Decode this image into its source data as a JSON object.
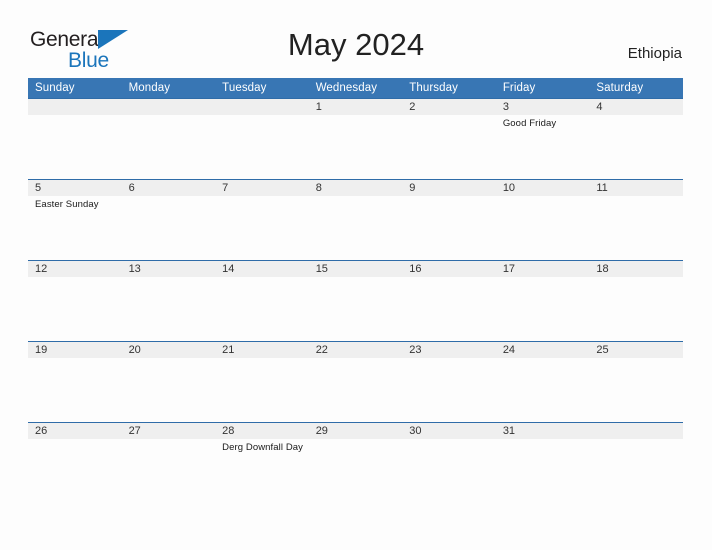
{
  "brand": {
    "name_top": "General",
    "name_bottom": "Blue",
    "flag_icon": "blue-triangle-flag-icon"
  },
  "header": {
    "title": "May 2024",
    "country": "Ethiopia"
  },
  "calendar": {
    "weekday_headers": [
      "Sunday",
      "Monday",
      "Tuesday",
      "Wednesday",
      "Thursday",
      "Friday",
      "Saturday"
    ],
    "weeks": [
      [
        {
          "day": "",
          "event": ""
        },
        {
          "day": "",
          "event": ""
        },
        {
          "day": "",
          "event": ""
        },
        {
          "day": "1",
          "event": ""
        },
        {
          "day": "2",
          "event": ""
        },
        {
          "day": "3",
          "event": "Good Friday"
        },
        {
          "day": "4",
          "event": ""
        }
      ],
      [
        {
          "day": "5",
          "event": "Easter Sunday"
        },
        {
          "day": "6",
          "event": ""
        },
        {
          "day": "7",
          "event": ""
        },
        {
          "day": "8",
          "event": ""
        },
        {
          "day": "9",
          "event": ""
        },
        {
          "day": "10",
          "event": ""
        },
        {
          "day": "11",
          "event": ""
        }
      ],
      [
        {
          "day": "12",
          "event": ""
        },
        {
          "day": "13",
          "event": ""
        },
        {
          "day": "14",
          "event": ""
        },
        {
          "day": "15",
          "event": ""
        },
        {
          "day": "16",
          "event": ""
        },
        {
          "day": "17",
          "event": ""
        },
        {
          "day": "18",
          "event": ""
        }
      ],
      [
        {
          "day": "19",
          "event": ""
        },
        {
          "day": "20",
          "event": ""
        },
        {
          "day": "21",
          "event": ""
        },
        {
          "day": "22",
          "event": ""
        },
        {
          "day": "23",
          "event": ""
        },
        {
          "day": "24",
          "event": ""
        },
        {
          "day": "25",
          "event": ""
        }
      ],
      [
        {
          "day": "26",
          "event": ""
        },
        {
          "day": "27",
          "event": ""
        },
        {
          "day": "28",
          "event": "Derg Downfall Day"
        },
        {
          "day": "29",
          "event": ""
        },
        {
          "day": "30",
          "event": ""
        },
        {
          "day": "31",
          "event": ""
        },
        {
          "day": "",
          "event": ""
        }
      ]
    ]
  },
  "colors": {
    "header_blue": "#3876b4",
    "rule_blue": "#2f6ca8",
    "day_band_gray": "#efefef",
    "brand_blue": "#1b75bb",
    "page_background": "#fdfdfd"
  }
}
